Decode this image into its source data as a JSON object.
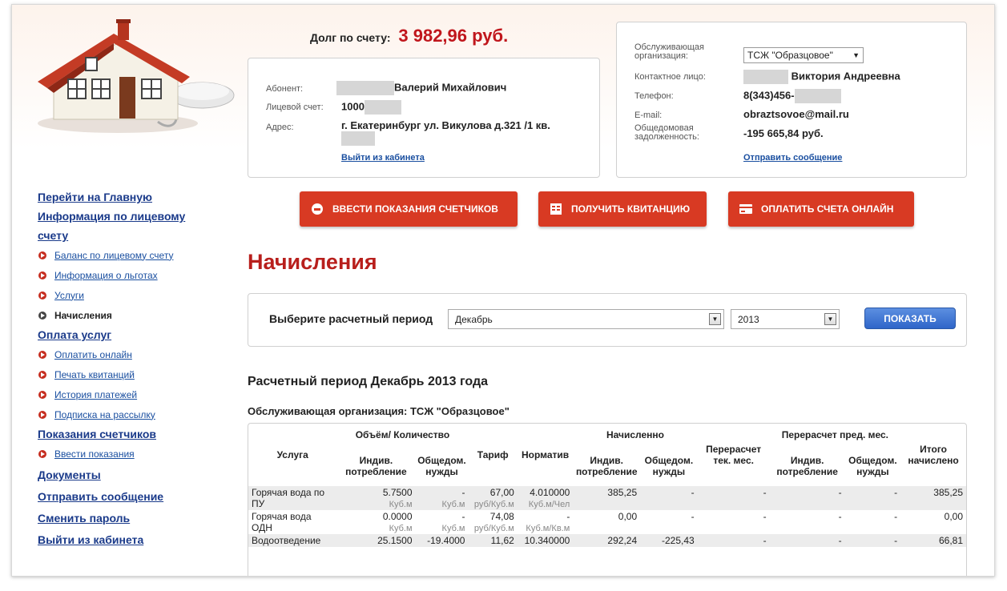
{
  "debt": {
    "label": "Долг по счету:",
    "amount": "3 982,96 руб."
  },
  "abonent": {
    "name_label": "Абонент:",
    "name_value": "Валерий Михайлович",
    "account_label": "Лицевой счет:",
    "account_value": "1000",
    "address_label": "Адрес:",
    "address_value": "г. Екатеринбург ул. Викулова д.321 /1 кв.",
    "logout_link": "Выйти из кабинета"
  },
  "org": {
    "org_label": "Обслуживающая организация:",
    "org_value": "ТСЖ \"Образцовое\"",
    "contact_label": "Контактное лицо:",
    "contact_value": "Виктория Андреевна",
    "phone_label": "Телефон:",
    "phone_value": "8(343)456-",
    "email_label": "E-mail:",
    "email_value": "obraztsovoe@mail.ru",
    "debt_label": "Общедомовая задолженность:",
    "debt_value": "-195 665,84 руб.",
    "send_link": "Отправить сообщение"
  },
  "buttons": {
    "meters": "ВВЕСТИ ПОКАЗАНИЯ СЧЕТЧИКОВ",
    "receipt": "ПОЛУЧИТЬ КВИТАНЦИЮ",
    "pay": "ОПЛАТИТЬ СЧЕТА ОНЛАЙН"
  },
  "sidebar": {
    "home": "Перейти на Главную",
    "account_info": "Информация по лицевому счету",
    "account_items": [
      "Баланс по лицевому счету",
      "Информация о льготах",
      "Услуги"
    ],
    "active_item": "Начисления",
    "payment": "Оплата услуг",
    "payment_items": [
      "Оплатить онлайн",
      "Печать квитанций",
      "История платежей",
      "Подписка на рассылку"
    ],
    "meters": "Показания счетчиков",
    "meters_items": [
      "Ввести показания"
    ],
    "docs": "Документы",
    "send_msg": "Отправить сообщение",
    "change_pwd": "Сменить пароль",
    "logout": "Выйти из кабинета"
  },
  "main": {
    "title": "Начисления",
    "period_label": "Выберите расчетный период",
    "month": "Декабрь",
    "year": "2013",
    "show_button": "ПОКАЗАТЬ",
    "period_title": "Расчетный период Декабрь 2013 года",
    "org_line": "Обслуживающая организация: ТСЖ \"Образцовое\""
  },
  "table": {
    "headers": {
      "service": "Услуга",
      "volume": "Объём/ Количество",
      "vol_ind": "Индив. потребление",
      "vol_common": "Общедом. нужды",
      "tariff": "Тариф",
      "norm": "Норматив",
      "charged": "Начисленно",
      "ch_ind": "Индив. потребление",
      "ch_common": "Общедом. нужды",
      "recalc_cur": "Перерасчет тек. мес.",
      "recalc_prev": "Перерасчет пред. мес.",
      "rp_ind": "Индив. потребление",
      "rp_common": "Общедом. нужды",
      "total": "Итого начислено"
    },
    "rows": [
      {
        "service": "Горячая вода по ПУ",
        "vol_ind": "5.7500",
        "vol_common": "-",
        "tariff": "67,00",
        "norm": "4.010000",
        "ch_ind": "385,25",
        "ch_common": "-",
        "recalc_cur": "-",
        "rp_ind": "-",
        "rp_common": "-",
        "total": "385,25",
        "u_vol_ind": "Куб.м",
        "u_vol_common": "Куб.м",
        "u_tariff": "руб/Куб.м",
        "u_norm": "Куб.м/Чел"
      },
      {
        "service": "Горячая вода ОДН",
        "vol_ind": "0.0000",
        "vol_common": "-",
        "tariff": "74,08",
        "norm": "-",
        "ch_ind": "0,00",
        "ch_common": "-",
        "recalc_cur": "-",
        "rp_ind": "-",
        "rp_common": "-",
        "total": "0,00",
        "u_vol_ind": "Куб.м",
        "u_vol_common": "Куб.м",
        "u_tariff": "руб/Куб.м",
        "u_norm": "Куб.м/Кв.м"
      },
      {
        "service": "Водоотведение",
        "vol_ind": "25.1500",
        "vol_common": "-19.4000",
        "tariff": "11,62",
        "norm": "10.340000",
        "ch_ind": "292,24",
        "ch_common": "-225,43",
        "recalc_cur": "-",
        "rp_ind": "-",
        "rp_common": "-",
        "total": "66,81"
      }
    ]
  }
}
